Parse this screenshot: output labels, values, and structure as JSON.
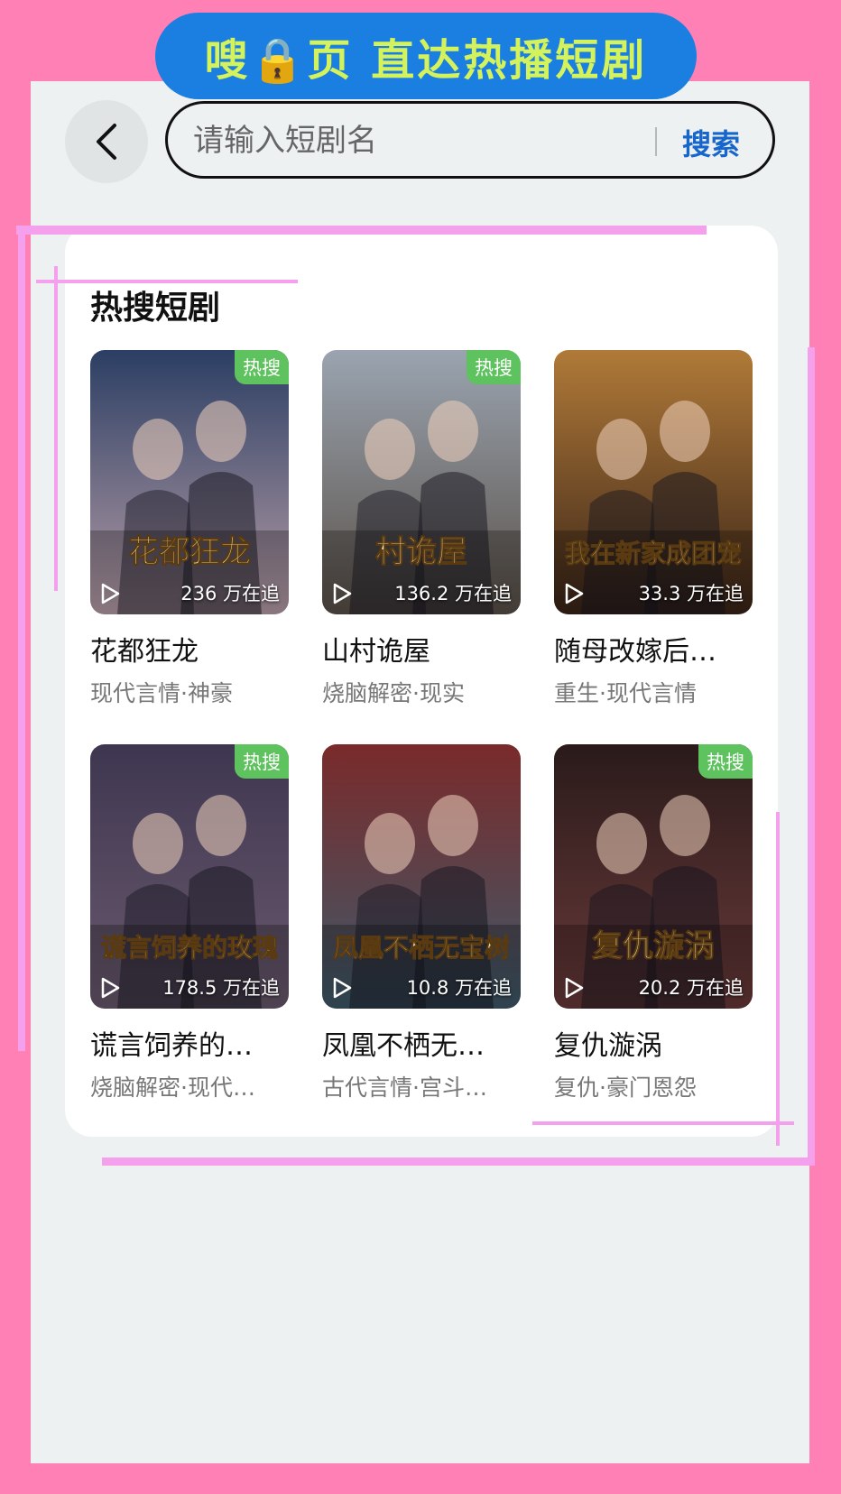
{
  "banner": {
    "text": "嗖🔒页 直达热播短剧"
  },
  "search": {
    "placeholder": "请输入短剧名",
    "button": "搜索"
  },
  "section": {
    "title": "热搜短剧"
  },
  "colors": {
    "accent": "#1766cc",
    "hot_badge": "#5ec25e",
    "banner_bg": "#1a7fe0",
    "banner_text": "#d4f25b",
    "frame": "#ff80b4"
  },
  "dramas": [
    {
      "title": "花都狂龙",
      "tags": "现代言情·神豪",
      "views": "236 万在追",
      "hot": "热搜",
      "poster_text": "花都狂龙",
      "poster_bg": [
        "#2b3e63",
        "#b89ea8"
      ]
    },
    {
      "title": "山村诡屋",
      "tags": "烧脑解密·现实",
      "views": "136.2 万在追",
      "hot": "热搜",
      "poster_text": "村诡屋",
      "poster_bg": [
        "#9aa4b0",
        "#5a5048"
      ]
    },
    {
      "title": "随母改嫁后…",
      "tags": "重生·现代言情",
      "views": "33.3 万在追",
      "hot": "",
      "poster_text": "我在新家成团宠",
      "poster_bg": [
        "#b07a38",
        "#3a2418"
      ]
    },
    {
      "title": "谎言饲养的…",
      "tags": "烧脑解密·现代…",
      "views": "178.5 万在追",
      "hot": "热搜",
      "poster_text": "谎言饲养的玫瑰",
      "poster_bg": [
        "#3e3650",
        "#6a5a6e"
      ]
    },
    {
      "title": "凤凰不栖无…",
      "tags": "古代言情·宫斗…",
      "views": "10.8 万在追",
      "hot": "",
      "poster_text": "凤凰不栖无宝树",
      "poster_bg": [
        "#7a2a2a",
        "#3e5a6a"
      ]
    },
    {
      "title": "复仇漩涡",
      "tags": "复仇·豪门恩怨",
      "views": "20.2 万在追",
      "hot": "热搜",
      "poster_text": "复仇漩涡",
      "poster_bg": [
        "#2a1a1a",
        "#6a3a3a"
      ]
    }
  ]
}
